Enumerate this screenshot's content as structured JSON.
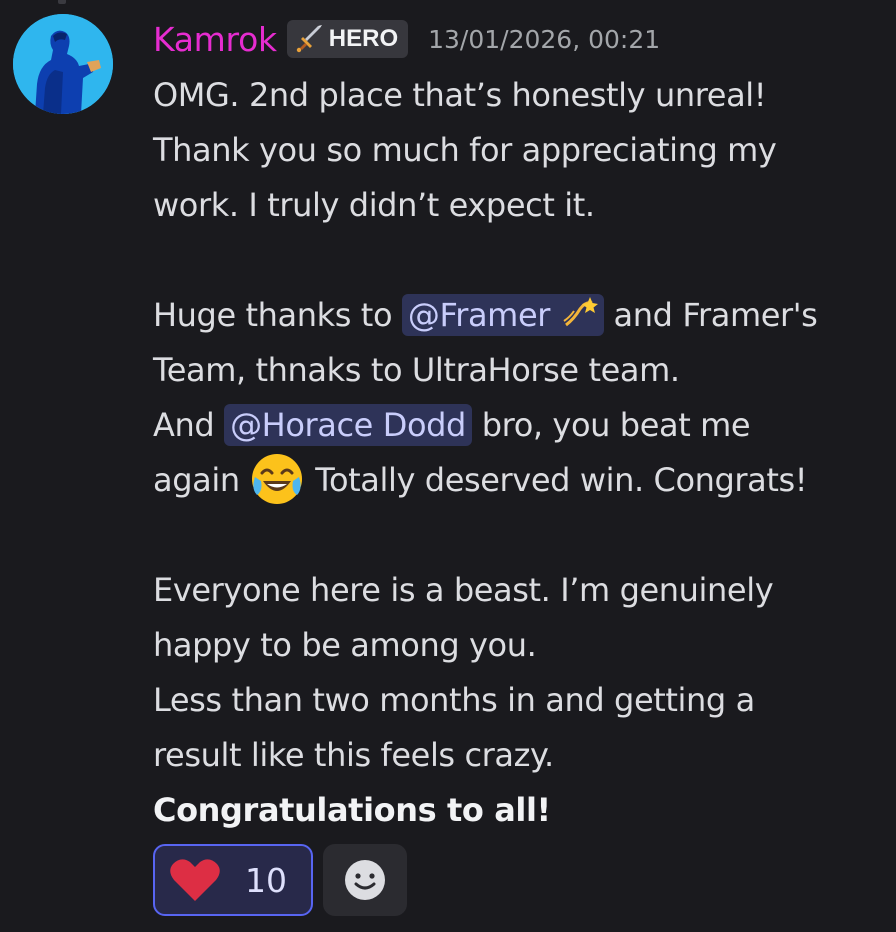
{
  "message": {
    "author": "Kamrok",
    "author_color": "#e62cd0",
    "role_tag": {
      "icon": "sword-icon",
      "label": "HERO"
    },
    "timestamp": "13/01/2026, 00:21",
    "lines": {
      "l1": "OMG. 2nd place that’s honestly unreal!",
      "l2": "Thank you so much for appreciating my",
      "l3": "work. I truly didn’t expect it.",
      "l4_pre": "Huge thanks to ",
      "l4_mention": "@Framer",
      "l4_emoji": "dizzy-emoji",
      "l4_post": " and Framer's",
      "l5": "Team, thnaks to UltraHorse team.",
      "l6_pre": "And ",
      "l6_mention": "@Horace Dodd",
      "l6_post": "  bro, you beat me",
      "l7_pre": "again ",
      "l7_emoji": "tears-of-joy-emoji",
      "l7_post": " Totally deserved win. Congrats!",
      "l8": "Everyone here is a beast. I’m genuinely",
      "l9": "happy to be among you.",
      "l10": "Less than two months in and getting a",
      "l11": "result like this feels crazy.",
      "l12": "Congratulations to all!"
    }
  },
  "reactions": [
    {
      "emoji": "red-heart-icon",
      "count": "10",
      "selected": true
    }
  ],
  "add_reaction": {
    "icon": "smiley-icon"
  },
  "colors": {
    "background": "#1a1a1e",
    "mention_bg": "#2e3358",
    "accent": "#5865f2",
    "avatar_bg": "#2fb6ee"
  }
}
